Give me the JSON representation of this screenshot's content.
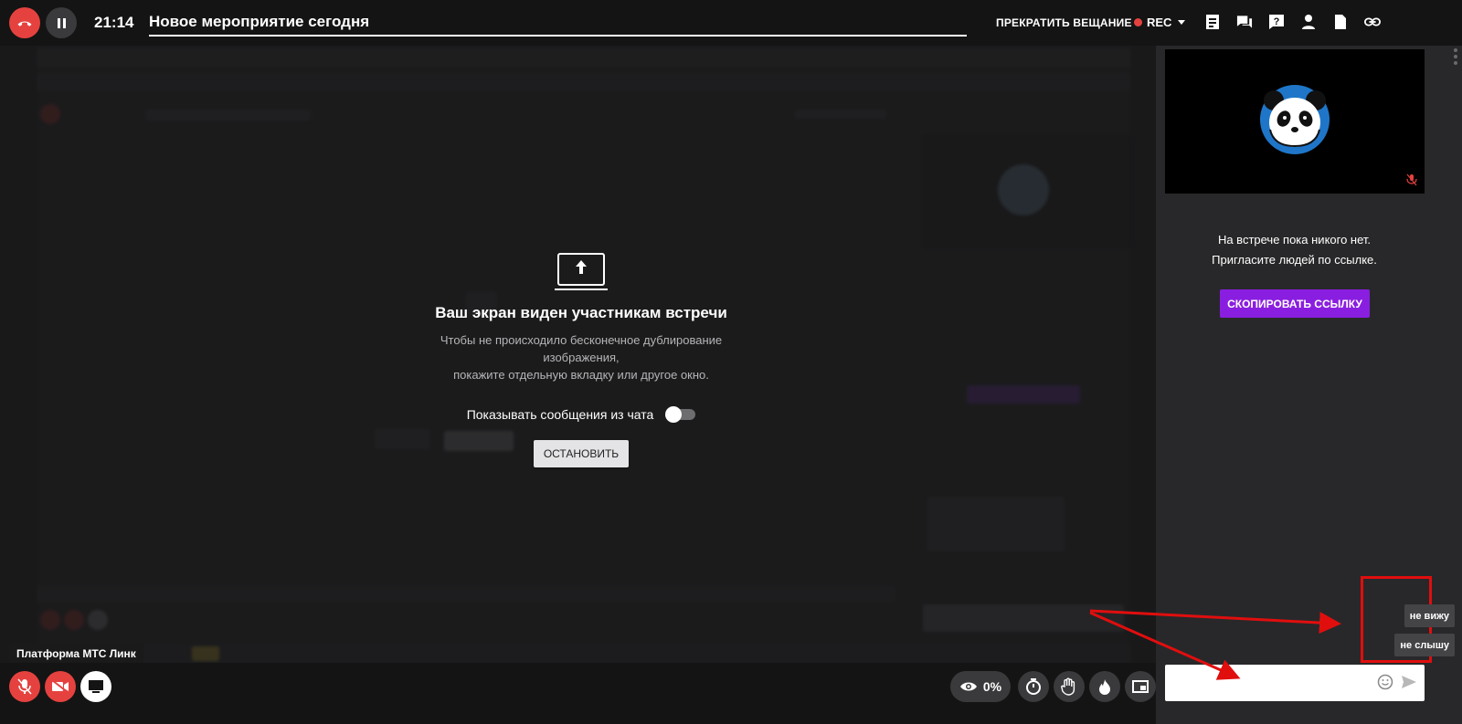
{
  "header": {
    "time": "21:14",
    "title": "Новое мероприятие сегодня",
    "stop_stream": "ПРЕКРАТИТЬ ВЕЩАНИЕ",
    "rec": "REC",
    "icons": [
      "end-call-icon",
      "pause-icon",
      "notes-icon",
      "chat-icon",
      "question-icon",
      "participants-icon",
      "document-icon",
      "link-icon"
    ]
  },
  "share": {
    "title": "Ваш экран виден участникам встречи",
    "desc_line1": "Чтобы не происходило бесконечное дублирование изображения,",
    "desc_line2": "покажите отдельную вкладку или другое окно.",
    "toggle_label": "Показывать сообщения из чата",
    "toggle_on": false,
    "stop_button": "ОСТАНОВИТЬ"
  },
  "tooltip": "Платформа МТС Линк",
  "bottom": {
    "viewers": "0%",
    "icons": [
      "mic-off-icon",
      "camera-off-icon",
      "screen-share-icon",
      "eye-icon",
      "timer-icon",
      "hand-icon",
      "fire-icon",
      "pip-icon"
    ]
  },
  "sidebar": {
    "empty_line1": "На встрече пока никого нет.",
    "empty_line2": "Пригласите людей по ссылке.",
    "copy_link": "СКОПИРОВАТЬ ССЫЛКУ",
    "quick_replies": [
      "не вижу",
      "не слышу"
    ],
    "chat_placeholder": ""
  },
  "colors": {
    "danger": "#e5423f",
    "accent": "#8a1ee0",
    "highlight": "#e10e0e"
  }
}
